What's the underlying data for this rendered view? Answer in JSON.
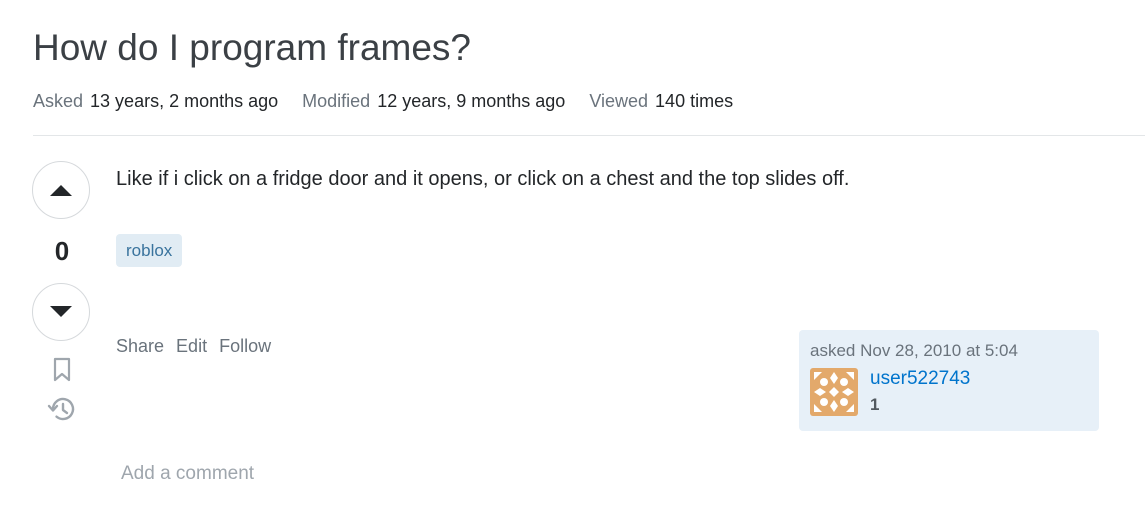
{
  "question": {
    "title": "How do I program frames?",
    "meta": {
      "asked_label": "Asked",
      "asked_value": "13 years, 2 months ago",
      "modified_label": "Modified",
      "modified_value": "12 years, 9 months ago",
      "viewed_label": "Viewed",
      "viewed_value": "140 times"
    },
    "vote_count": "0",
    "body": "Like if i click on a fridge door and it opens, or click on a chest and the top slides off.",
    "tags": [
      "roblox"
    ],
    "menu": {
      "share": "Share",
      "edit": "Edit",
      "follow": "Follow"
    },
    "user_card": {
      "asked_time": "asked Nov 28, 2010 at 5:04",
      "user_name": "user522743",
      "reputation": "1"
    },
    "add_comment": "Add a comment"
  },
  "colors": {
    "link": "#0074cc",
    "tag_bg": "#e1ecf4",
    "tag_text": "#39739d",
    "user_card_bg": "#e7f0f8",
    "avatar": "#e3a96b"
  },
  "icons": {
    "upvote": "upvote-arrow-icon",
    "downvote": "downvote-arrow-icon",
    "bookmark": "bookmark-icon",
    "history": "history-icon"
  }
}
